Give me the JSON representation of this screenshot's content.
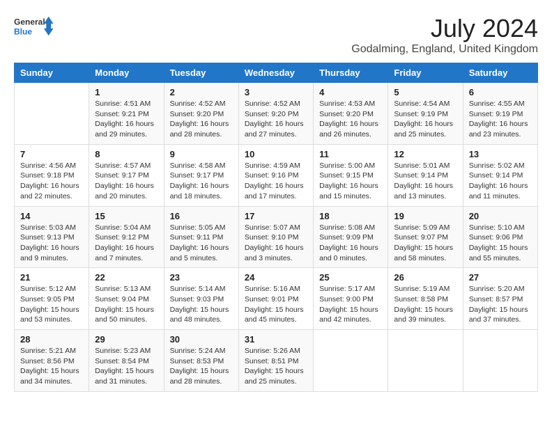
{
  "header": {
    "logo_general": "General",
    "logo_blue": "Blue",
    "title": "July 2024",
    "location": "Godalming, England, United Kingdom"
  },
  "calendar": {
    "days_of_week": [
      "Sunday",
      "Monday",
      "Tuesday",
      "Wednesday",
      "Thursday",
      "Friday",
      "Saturday"
    ],
    "weeks": [
      [
        {
          "day": "",
          "info": ""
        },
        {
          "day": "1",
          "info": "Sunrise: 4:51 AM\nSunset: 9:21 PM\nDaylight: 16 hours\nand 29 minutes."
        },
        {
          "day": "2",
          "info": "Sunrise: 4:52 AM\nSunset: 9:20 PM\nDaylight: 16 hours\nand 28 minutes."
        },
        {
          "day": "3",
          "info": "Sunrise: 4:52 AM\nSunset: 9:20 PM\nDaylight: 16 hours\nand 27 minutes."
        },
        {
          "day": "4",
          "info": "Sunrise: 4:53 AM\nSunset: 9:20 PM\nDaylight: 16 hours\nand 26 minutes."
        },
        {
          "day": "5",
          "info": "Sunrise: 4:54 AM\nSunset: 9:19 PM\nDaylight: 16 hours\nand 25 minutes."
        },
        {
          "day": "6",
          "info": "Sunrise: 4:55 AM\nSunset: 9:19 PM\nDaylight: 16 hours\nand 23 minutes."
        }
      ],
      [
        {
          "day": "7",
          "info": "Sunrise: 4:56 AM\nSunset: 9:18 PM\nDaylight: 16 hours\nand 22 minutes."
        },
        {
          "day": "8",
          "info": "Sunrise: 4:57 AM\nSunset: 9:17 PM\nDaylight: 16 hours\nand 20 minutes."
        },
        {
          "day": "9",
          "info": "Sunrise: 4:58 AM\nSunset: 9:17 PM\nDaylight: 16 hours\nand 18 minutes."
        },
        {
          "day": "10",
          "info": "Sunrise: 4:59 AM\nSunset: 9:16 PM\nDaylight: 16 hours\nand 17 minutes."
        },
        {
          "day": "11",
          "info": "Sunrise: 5:00 AM\nSunset: 9:15 PM\nDaylight: 16 hours\nand 15 minutes."
        },
        {
          "day": "12",
          "info": "Sunrise: 5:01 AM\nSunset: 9:14 PM\nDaylight: 16 hours\nand 13 minutes."
        },
        {
          "day": "13",
          "info": "Sunrise: 5:02 AM\nSunset: 9:14 PM\nDaylight: 16 hours\nand 11 minutes."
        }
      ],
      [
        {
          "day": "14",
          "info": "Sunrise: 5:03 AM\nSunset: 9:13 PM\nDaylight: 16 hours\nand 9 minutes."
        },
        {
          "day": "15",
          "info": "Sunrise: 5:04 AM\nSunset: 9:12 PM\nDaylight: 16 hours\nand 7 minutes."
        },
        {
          "day": "16",
          "info": "Sunrise: 5:05 AM\nSunset: 9:11 PM\nDaylight: 16 hours\nand 5 minutes."
        },
        {
          "day": "17",
          "info": "Sunrise: 5:07 AM\nSunset: 9:10 PM\nDaylight: 16 hours\nand 3 minutes."
        },
        {
          "day": "18",
          "info": "Sunrise: 5:08 AM\nSunset: 9:09 PM\nDaylight: 16 hours\nand 0 minutes."
        },
        {
          "day": "19",
          "info": "Sunrise: 5:09 AM\nSunset: 9:07 PM\nDaylight: 15 hours\nand 58 minutes."
        },
        {
          "day": "20",
          "info": "Sunrise: 5:10 AM\nSunset: 9:06 PM\nDaylight: 15 hours\nand 55 minutes."
        }
      ],
      [
        {
          "day": "21",
          "info": "Sunrise: 5:12 AM\nSunset: 9:05 PM\nDaylight: 15 hours\nand 53 minutes."
        },
        {
          "day": "22",
          "info": "Sunrise: 5:13 AM\nSunset: 9:04 PM\nDaylight: 15 hours\nand 50 minutes."
        },
        {
          "day": "23",
          "info": "Sunrise: 5:14 AM\nSunset: 9:03 PM\nDaylight: 15 hours\nand 48 minutes."
        },
        {
          "day": "24",
          "info": "Sunrise: 5:16 AM\nSunset: 9:01 PM\nDaylight: 15 hours\nand 45 minutes."
        },
        {
          "day": "25",
          "info": "Sunrise: 5:17 AM\nSunset: 9:00 PM\nDaylight: 15 hours\nand 42 minutes."
        },
        {
          "day": "26",
          "info": "Sunrise: 5:19 AM\nSunset: 8:58 PM\nDaylight: 15 hours\nand 39 minutes."
        },
        {
          "day": "27",
          "info": "Sunrise: 5:20 AM\nSunset: 8:57 PM\nDaylight: 15 hours\nand 37 minutes."
        }
      ],
      [
        {
          "day": "28",
          "info": "Sunrise: 5:21 AM\nSunset: 8:56 PM\nDaylight: 15 hours\nand 34 minutes."
        },
        {
          "day": "29",
          "info": "Sunrise: 5:23 AM\nSunset: 8:54 PM\nDaylight: 15 hours\nand 31 minutes."
        },
        {
          "day": "30",
          "info": "Sunrise: 5:24 AM\nSunset: 8:53 PM\nDaylight: 15 hours\nand 28 minutes."
        },
        {
          "day": "31",
          "info": "Sunrise: 5:26 AM\nSunset: 8:51 PM\nDaylight: 15 hours\nand 25 minutes."
        },
        {
          "day": "",
          "info": ""
        },
        {
          "day": "",
          "info": ""
        },
        {
          "day": "",
          "info": ""
        }
      ]
    ]
  }
}
